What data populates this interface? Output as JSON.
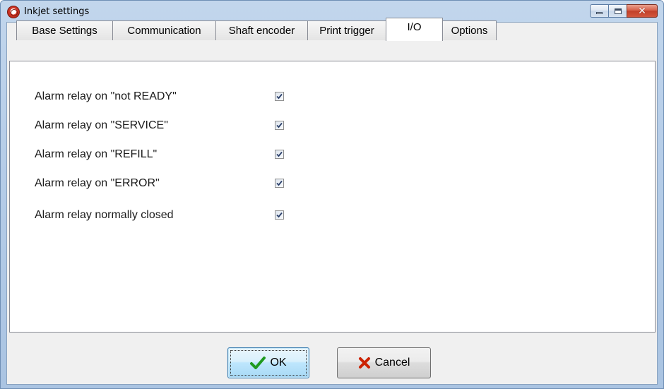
{
  "window": {
    "title": "Inkjet settings",
    "icon": "app-logo-icon",
    "controls": [
      "minimize-icon",
      "maximize-icon",
      "close-icon"
    ]
  },
  "tabs": [
    {
      "label": "Base Settings",
      "active": false
    },
    {
      "label": "Communication",
      "active": false
    },
    {
      "label": "Shaft encoder",
      "active": false
    },
    {
      "label": "Print trigger",
      "active": false
    },
    {
      "label": "I/O",
      "active": true
    },
    {
      "label": "Options",
      "active": false
    }
  ],
  "io_options": [
    {
      "label": "Alarm relay on \"not READY\"",
      "checked": true
    },
    {
      "label": "Alarm relay on \"SERVICE\"",
      "checked": true
    },
    {
      "label": "Alarm relay on \"REFILL\"",
      "checked": true
    },
    {
      "label": "Alarm relay on \"ERROR\"",
      "checked": true
    },
    {
      "label": "Alarm relay normally closed",
      "checked": true
    }
  ],
  "buttons": {
    "ok_label": "OK",
    "ok_icon": "checkmark-icon",
    "cancel_label": "Cancel",
    "cancel_icon": "x-mark-icon"
  },
  "colors": {
    "checkmark": "#1f9a1f",
    "cancel_x": "#cc2200"
  }
}
